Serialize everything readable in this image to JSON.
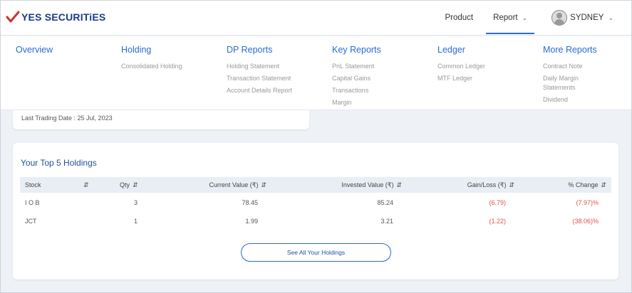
{
  "header": {
    "brand": "YES SECURITiES",
    "nav": {
      "product": "Product",
      "report": "Report"
    },
    "user_name": "SYDNEY"
  },
  "menu": {
    "overview": "Overview",
    "holding": {
      "title": "Holding",
      "items": [
        "Consolidated Holding"
      ]
    },
    "dp_reports": {
      "title": "DP Reports",
      "items": [
        "Holding Statement",
        "Transaction Statement",
        "Account Details Report"
      ]
    },
    "key_reports": {
      "title": "Key Reports",
      "items": [
        "PnL Statement",
        "Capital Gains",
        "Transactions",
        "Margin"
      ]
    },
    "ledger": {
      "title": "Ledger",
      "items": [
        "Common Ledger",
        "MTF Ledger"
      ]
    },
    "more_reports": {
      "title": "More Reports",
      "items": [
        "Contract Note",
        "Daily Margin Statements",
        "Dividend"
      ]
    }
  },
  "last_trading_date": "Last Trading Date : 25 Jul, 2023",
  "holdings": {
    "title": "Your Top 5 Holdings",
    "columns": [
      "Stock",
      "Qty",
      "Current Value (₹)",
      "Invested Value (₹)",
      "Gain/Loss (₹)",
      "% Change"
    ],
    "rows": [
      {
        "stock": "I O B",
        "qty": "3",
        "current": "78.45",
        "invested": "85.24",
        "gain": "(6.79)",
        "change": "(7.97)%"
      },
      {
        "stock": "JCT",
        "qty": "1",
        "current": "1.99",
        "invested": "3.21",
        "gain": "(1.22)",
        "change": "(38.06)%"
      }
    ],
    "see_all": "See All Your Holdings"
  },
  "colors": {
    "accent": "#2a6bd1",
    "brand": "#1a3a8a",
    "negative": "#e05050",
    "check": "#d32f2f"
  },
  "icons": [
    "checkmark-logo-icon",
    "chevron-down-icon",
    "avatar-icon",
    "sort-icon"
  ]
}
